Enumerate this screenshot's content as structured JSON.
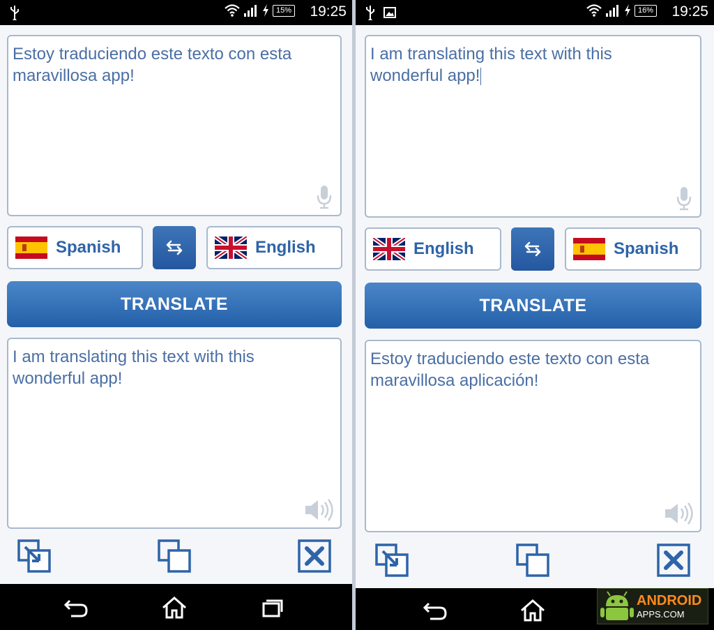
{
  "phones": [
    {
      "status": {
        "time": "19:25",
        "battery": "15%"
      },
      "input_text": "Estoy traduciendo este texto con esta\nmaravillosa app!",
      "source_lang": "Spanish",
      "source_flag": "spain-flag",
      "target_lang": "English",
      "target_flag": "uk-flag",
      "translate_label": "TRANSLATE",
      "output_text": "I am translating this text with this\nwonderful app!"
    },
    {
      "status": {
        "time": "19:25",
        "battery": "16%"
      },
      "input_text": "I am translating this text with this\nwonderful app!",
      "source_lang": "English",
      "source_flag": "uk-flag",
      "target_lang": "Spanish",
      "target_flag": "spain-flag",
      "translate_label": "TRANSLATE",
      "output_text": "Estoy traduciendo este texto con esta\nmaravillosa aplicación!"
    }
  ],
  "watermark": {
    "line1": "ANDROID",
    "line2": "APPS.COM"
  },
  "colors": {
    "accent": "#2e64a8",
    "text": "#4a6fa5",
    "border": "#a9b9cc"
  }
}
